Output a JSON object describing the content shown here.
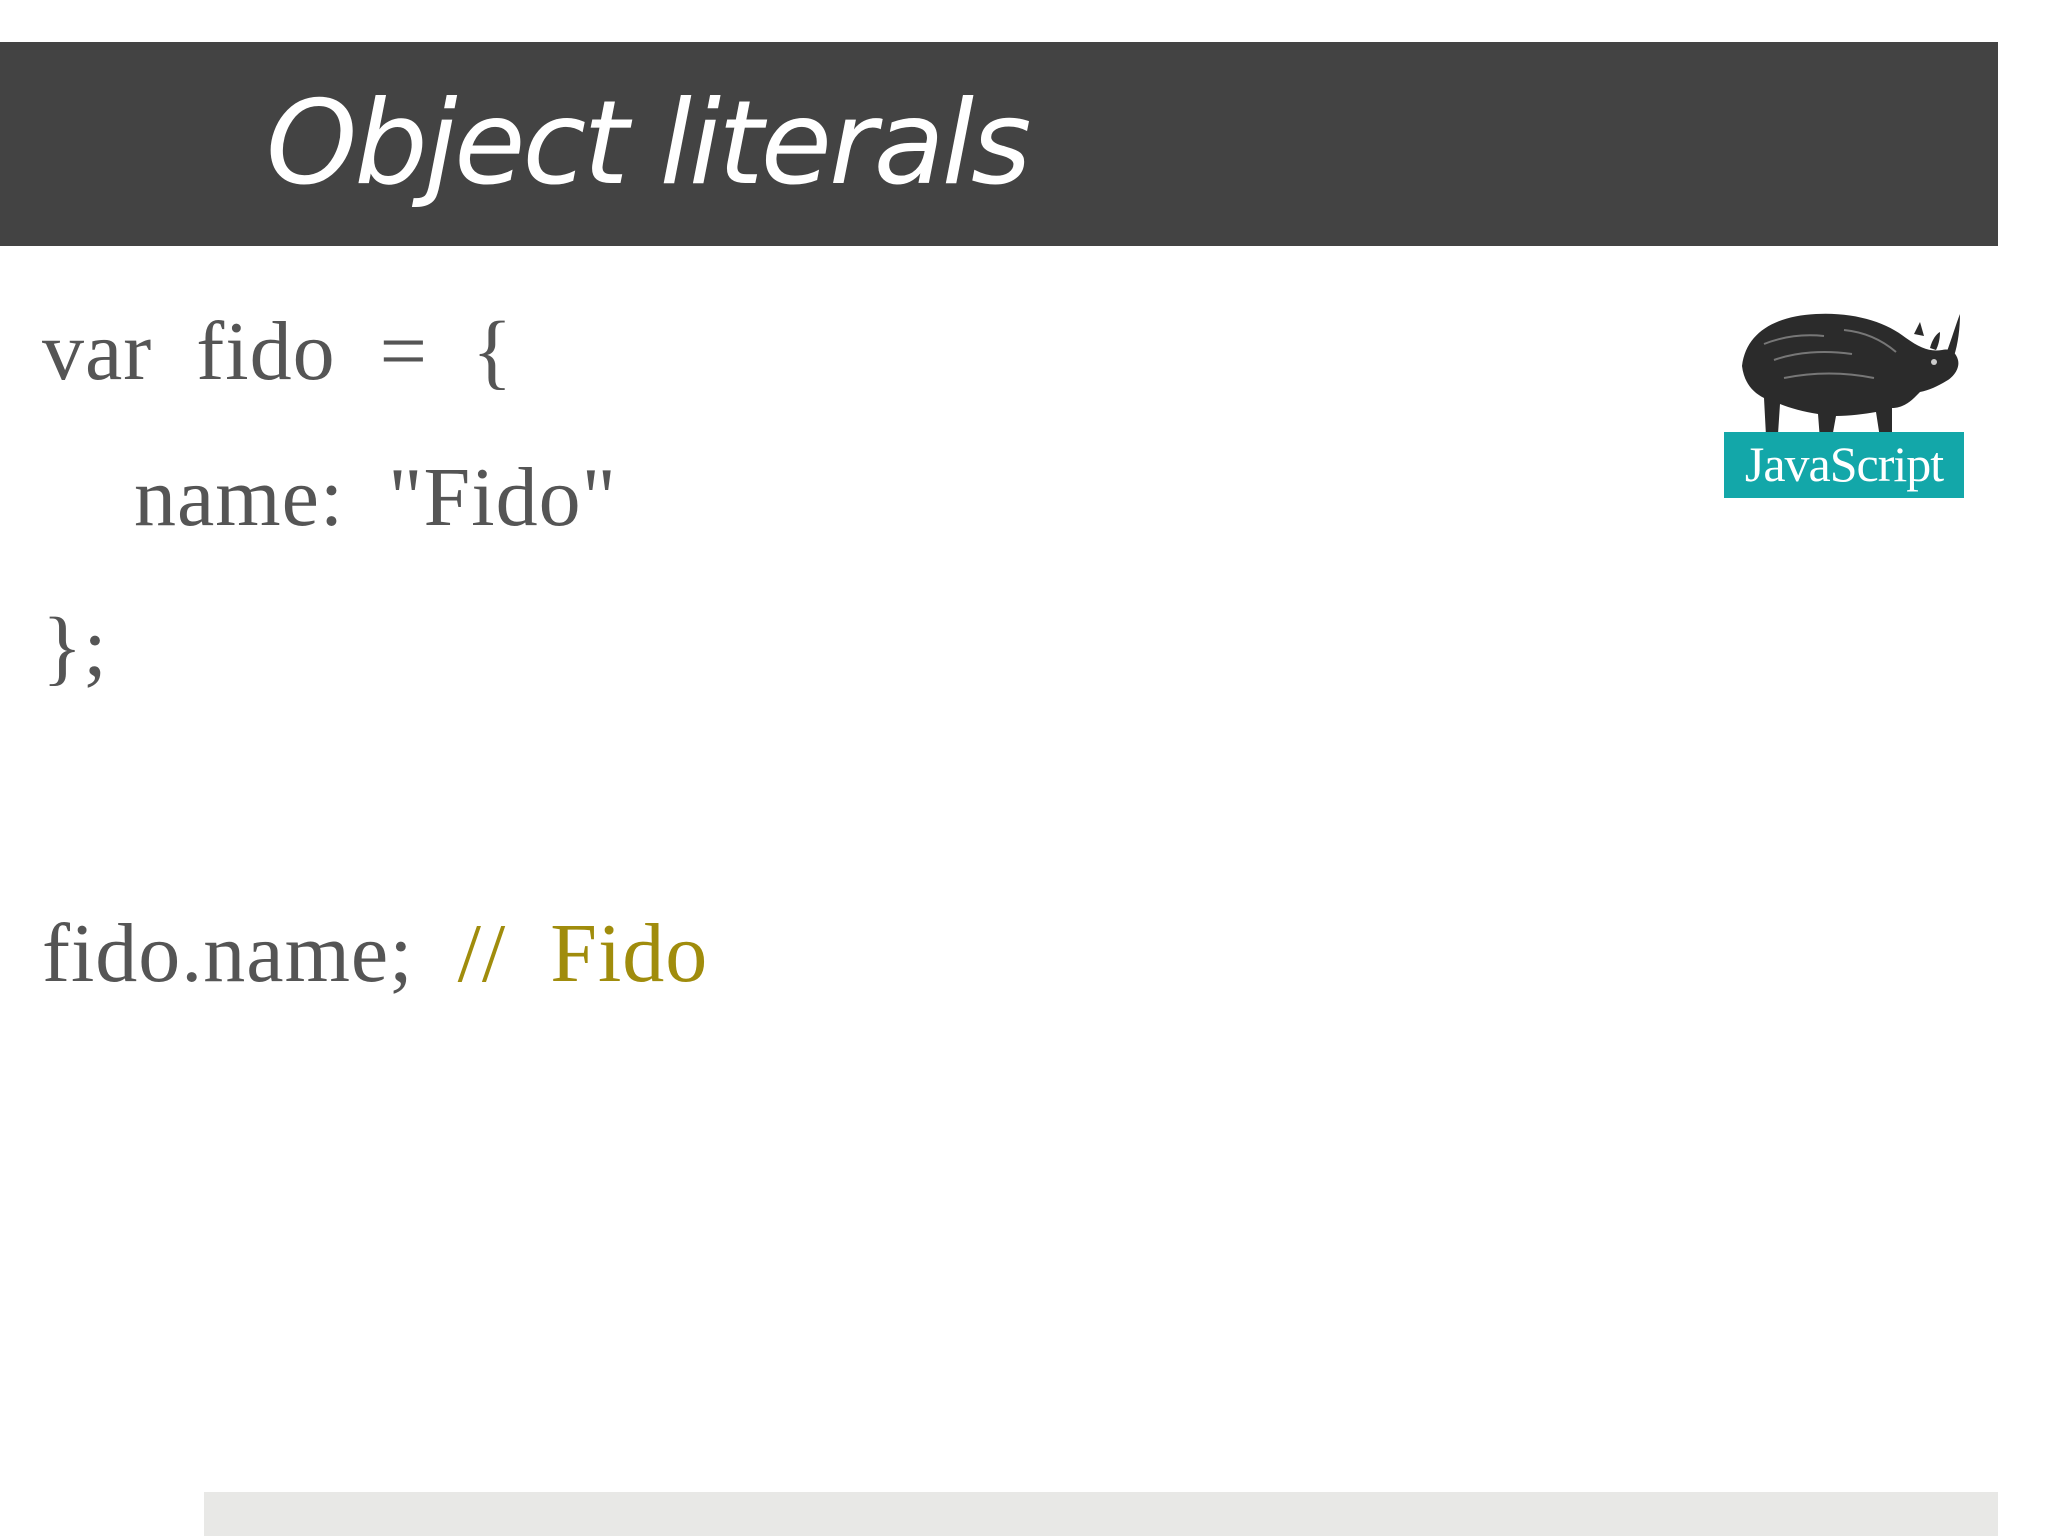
{
  "slide": {
    "title": "Object literals",
    "code": {
      "line1": "var  fido  =  {",
      "line2": "name:  \"Fido\"",
      "line3": "};",
      "line4_code": "fido.name;  ",
      "line4_comment": "//  Fido"
    },
    "logo": {
      "icon": "rhino-icon",
      "label": "JavaScript"
    },
    "colors": {
      "title_bar": "#434343",
      "code_text": "#555555",
      "comment_text": "#a08c0c",
      "logo_badge": "#13a7a9"
    }
  }
}
